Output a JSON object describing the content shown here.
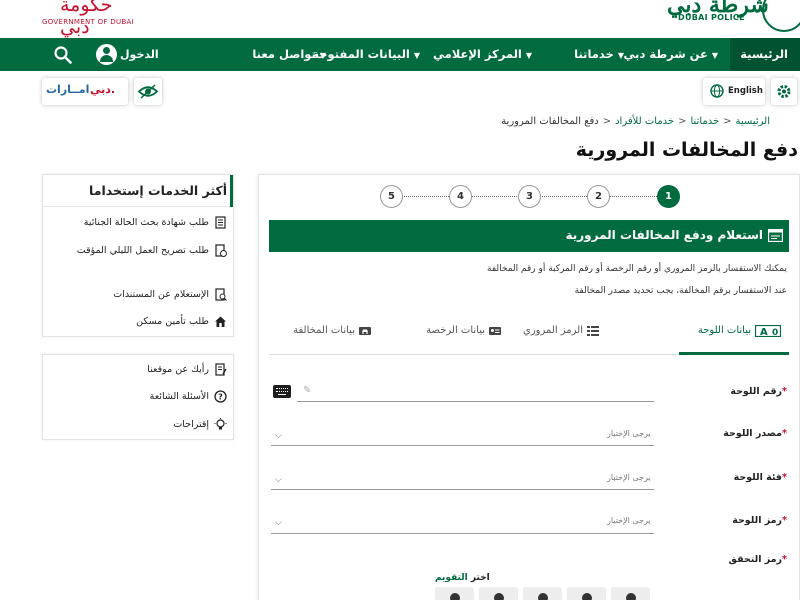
{
  "header": {
    "gov_logo_ar": "حكومة دبي",
    "gov_logo_en": "GOVERNMENT OF DUBAI",
    "police_logo_ar": "شرطة دبي",
    "police_logo_en": "DUBAI POLICE"
  },
  "nav": {
    "items": [
      {
        "label": "الرئيسية"
      },
      {
        "label": "عن شرطة دبي"
      },
      {
        "label": "خدماتنا"
      },
      {
        "label": "المركز الإعلامي"
      },
      {
        "label": "البيانات المفتوحة"
      },
      {
        "label": "تواصل معنا"
      }
    ],
    "login_label": "الدخول"
  },
  "utility": {
    "brand_a": "دبي.",
    "brand_b": "امــارات",
    "language": "English"
  },
  "breadcrumb": [
    "الرئيسية",
    "خدماتنا",
    "خدمات للأفراد",
    "دفع المخالفات المرورية"
  ],
  "page_title": "دفع المخالفات المرورية",
  "sidebar": {
    "most_used_title": "أكثر الخدمات إستخداما",
    "most_used": [
      {
        "label": "طلب شهادة بحث الحالة الجنائية"
      },
      {
        "label": "طلب تصريح العمل الليلي المؤقت"
      },
      {
        "label": "الإستعلام عن المستندات"
      },
      {
        "label": "طلب تأمين مسكن"
      }
    ],
    "links": [
      {
        "label": "رأيك عن موقعنا"
      },
      {
        "label": "الأسئلة الشائعة"
      },
      {
        "label": "إقتراحات"
      }
    ]
  },
  "steps": [
    "1",
    "2",
    "3",
    "4",
    "5"
  ],
  "banner_title": "استعلام ودفع المخالفات المرورية",
  "info_line_1": "يمكنك الاستفسار بالرمز المروري أو رقم الرخصة أو رقم المركبة أو رقم المخالفة",
  "info_line_2": "عند الاستفسار برقم المخالفة، يجب تحديد مصدر المخالفة",
  "tabs": [
    {
      "label": "بيانات اللوحة",
      "active": true
    },
    {
      "label": "الرمز المروري",
      "active": false
    },
    {
      "label": "بيانات الرخصة",
      "active": false
    },
    {
      "label": "بيانات المخالفة",
      "active": false
    }
  ],
  "form": {
    "plate_number_label": "رقم اللوحة",
    "plate_source_label": "مصدر اللوحة",
    "plate_category_label": "فئة اللوحة",
    "plate_code_label": "رمز اللوحة",
    "captcha_label": "رمز التحقق",
    "select_placeholder": "يرجى الإختيار",
    "required_mark": "*"
  },
  "captcha": {
    "prompt": "اختر",
    "target": "التقويم"
  },
  "colors": {
    "brand_green": "#006b3f",
    "dark_green": "#005230",
    "gov_red": "#c8102e"
  }
}
